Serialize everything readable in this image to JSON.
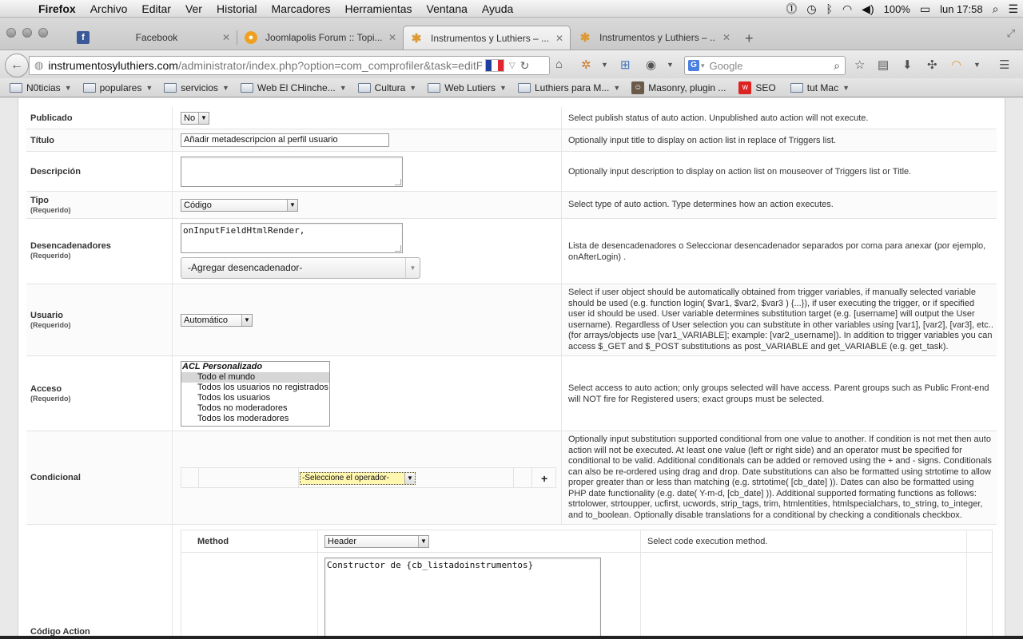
{
  "menubar": {
    "app": "Firefox",
    "items": [
      "Archivo",
      "Editar",
      "Ver",
      "Historial",
      "Marcadores",
      "Herramientas",
      "Ventana",
      "Ayuda"
    ],
    "battery": "100%",
    "clock": "lun 17:58"
  },
  "tabs": [
    {
      "title": "Facebook",
      "icon": "facebook-icon"
    },
    {
      "title": "Joomlapolis Forum :: Topi...",
      "icon": "joomlapolis-icon"
    },
    {
      "title": "Instrumentos y Luthiers – ...",
      "icon": "joomla-icon",
      "active": true
    },
    {
      "title": "Instrumentos y Luthiers – ...",
      "icon": "joomla-icon"
    }
  ],
  "url": {
    "host": "instrumentosyluthiers.com",
    "path": "/administrator/index.php?option=com_comprofiler&task=editPlug"
  },
  "search": {
    "placeholder": "Google"
  },
  "bookmarks": [
    {
      "label": "N0ticias",
      "type": "folder"
    },
    {
      "label": "populares",
      "type": "folder"
    },
    {
      "label": "servicios",
      "type": "folder"
    },
    {
      "label": "Web El CHinche...",
      "type": "folder"
    },
    {
      "label": "Cultura",
      "type": "folder"
    },
    {
      "label": "Web Lutiers",
      "type": "folder"
    },
    {
      "label": "Luthiers para M...",
      "type": "folder"
    },
    {
      "label": "Masonry, plugin ...",
      "type": "page"
    },
    {
      "label": "SEO",
      "type": "page"
    },
    {
      "label": "tut Mac",
      "type": "folder"
    }
  ],
  "form": {
    "publicado": {
      "label": "Publicado",
      "value": "No",
      "desc": "Select publish status of auto action. Unpublished auto action will not execute."
    },
    "titulo": {
      "label": "Título",
      "value": "Añadir metadescripcion al perfil usuario",
      "desc": "Optionally input title to display on action list in replace of Triggers list."
    },
    "descripcion": {
      "label": "Descripción",
      "value": "",
      "desc": "Optionally input description to display on action list on mouseover of Triggers list or Title."
    },
    "tipo": {
      "label": "Tipo",
      "required": "(Requerido)",
      "value": "Código",
      "desc": "Select type of auto action. Type determines how an action executes."
    },
    "desencadenadores": {
      "label": "Desencadenadores",
      "required": "(Requerido)",
      "value": "onInputFieldHtmlRender,",
      "add": "-Agregar desencadenador-",
      "desc": "Lista de desencadenadores o Seleccionar desencadenador separados por coma para anexar (por ejemplo, onAfterLogin) ."
    },
    "usuario": {
      "label": "Usuario",
      "required": "(Requerido)",
      "value": "Automático",
      "desc": "Select if user object should be automatically obtained from trigger variables, if manually selected variable should be used (e.g. function login( $var1, $var2, $var3 ) {...}), if user executing the trigger, or if specified user id should be used. User variable determines substitution target (e.g. [username] will output the User username). Regardless of User selection you can substitute in other variables using [var1], [var2], [var3], etc.. (for arrays/objects use [var1_VARIABLE]; example: [var2_username]). In addition to trigger variables you can access $_GET and $_POST substitutions as post_VARIABLE and get_VARIABLE (e.g. get_task)."
    },
    "acceso": {
      "label": "Acceso",
      "required": "(Requerido)",
      "options": [
        "ACL Personalizado",
        "Todo el mundo",
        "Todos los usuarios no registrados",
        "Todos los usuarios",
        "Todos no moderadores",
        "Todos los moderadores"
      ],
      "desc": "Select access to auto action; only groups selected will have access. Parent groups such as Public Front-end will NOT fire for Registered users; exact groups must be selected."
    },
    "condicional": {
      "label": "Condicional",
      "operator": "-Seleccione el operador-",
      "add": "+",
      "desc": "Optionally input substitution supported conditional from one value to another. If condition is not met then auto action will not be executed. At least one value (left or right side) and an operator must be specified for conditional to be valid. Additional conditionals can be added or removed using the + and - signs. Conditionals can also be re-ordered using drag and drop. Date substitutions can also be formatted using strtotime to allow proper greater than or less than matching (e.g. strtotime( [cb_date] )). Dates can also be formatted using PHP date functionality (e.g. date( Y-m-d, [cb_date] )). Additional supported formating functions as follows: strtolower, strtoupper, ucfirst, ucwords, strip_tags, trim, htmlentities, htmlspecialchars, to_string, to_integer, and to_boolean. Optionally disable translations for a conditional by checking a conditionals checkbox."
    },
    "codigo": {
      "label": "Código Action",
      "method_label": "Method",
      "method_value": "Header",
      "method_desc": "Select code execution method.",
      "code": "Constructor de {cb_listadoinstrumentos}"
    }
  }
}
